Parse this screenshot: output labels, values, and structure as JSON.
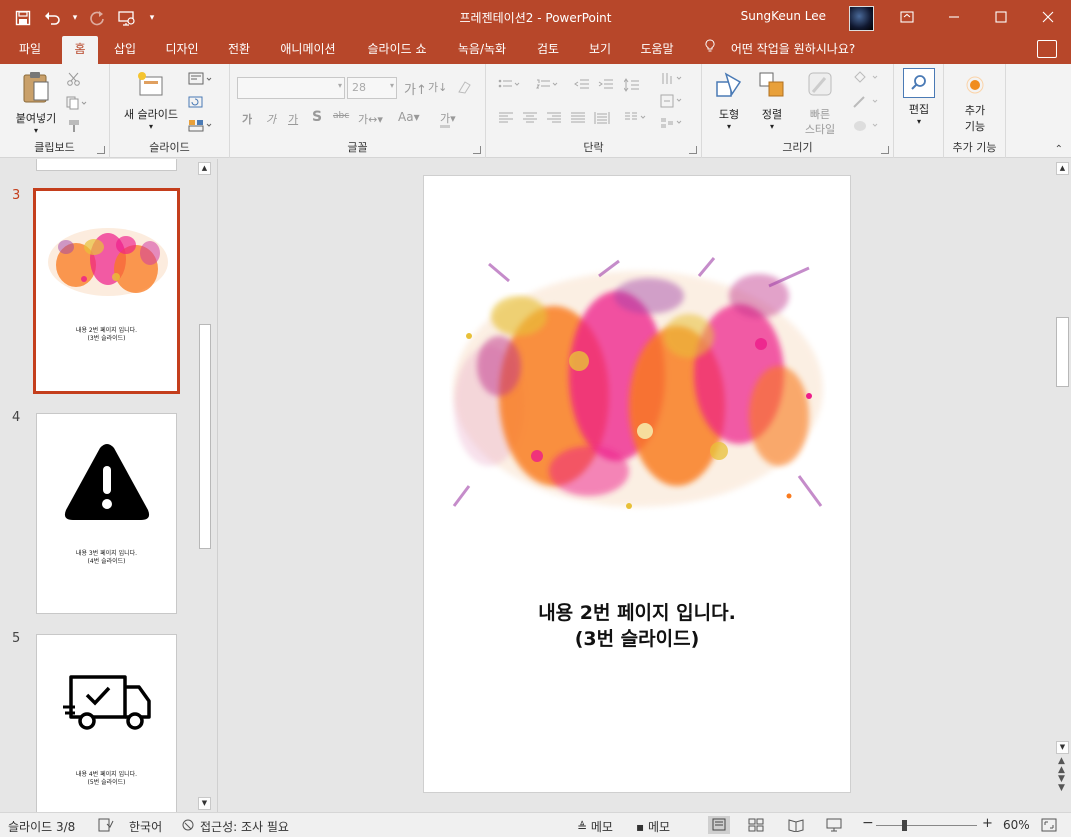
{
  "app": {
    "doc_title": "프레젠테이션2",
    "separator": "-",
    "app_name": "PowerPoint",
    "user_name": "SungKeun Lee",
    "accent_color": "#b7472a"
  },
  "quick_access": {
    "icons": [
      "save-icon",
      "undo-icon",
      "redo-icon",
      "present-from-beginning-icon",
      "customize-qat-icon"
    ]
  },
  "tabs": [
    {
      "label": "파일"
    },
    {
      "label": "홈",
      "active": true
    },
    {
      "label": "삽입"
    },
    {
      "label": "디자인"
    },
    {
      "label": "전환"
    },
    {
      "label": "애니메이션"
    },
    {
      "label": "슬라이드 쇼"
    },
    {
      "label": "녹음/녹화"
    },
    {
      "label": "검토"
    },
    {
      "label": "보기"
    },
    {
      "label": "도움말"
    }
  ],
  "tell_me": "어떤 작업을 원하시나요?",
  "ribbon": {
    "clipboard": {
      "paste": "붙여넣기",
      "label": "클립보드"
    },
    "slides": {
      "new_slide": "새 슬라이드",
      "label": "슬라이드"
    },
    "font": {
      "size": "28",
      "label": "글꼴",
      "case_label": "Aa",
      "spacing_label": "가"
    },
    "paragraph": {
      "label": "단락"
    },
    "drawing": {
      "shapes": "도형",
      "arrange": "정렬",
      "quick_styles_1": "빠른",
      "quick_styles_2": "스타일",
      "label": "그리기"
    },
    "editing": {
      "label": "편집"
    },
    "addins": {
      "line1": "추가",
      "line2": "기능",
      "label": "추가 기능"
    }
  },
  "thumbnails": [
    {
      "number": "3",
      "caption_line1": "내용 2번 페이지 입니다.",
      "caption_line2": "(3번 슬라이드)",
      "selected": true,
      "art": "paint-splash"
    },
    {
      "number": "4",
      "caption_line1": "내용 3번 페이지 입니다.",
      "caption_line2": "(4번 슬라이드)",
      "art": "warning-icon"
    },
    {
      "number": "5",
      "caption_line1": "내용 4번 페이지 입니다.",
      "caption_line2": "(5번 슬라이드)",
      "art": "delivery-truck-icon"
    }
  ],
  "slide": {
    "caption_line1": "내용 2번 페이지 입니다.",
    "caption_line2": "(3번 슬라이드)",
    "image": "paint-splash"
  },
  "status": {
    "slide_info": "슬라이드 3/8",
    "language": "한국어",
    "accessibility": "접근성: 조사 필요",
    "notes": "메모",
    "comments": "메모",
    "zoom": "60%",
    "zoom_minus": "−",
    "zoom_plus": "+",
    "zoom_level": 0.6
  }
}
